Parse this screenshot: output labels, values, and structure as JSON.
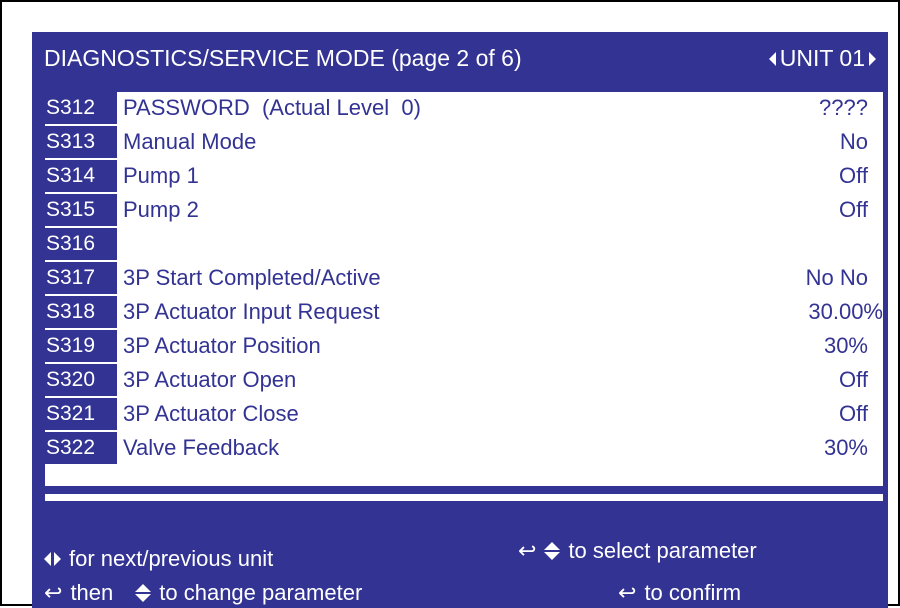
{
  "header": {
    "title": "DIAGNOSTICS/SERVICE MODE (page 2 of 6)",
    "unit": "UNIT 01"
  },
  "rows": [
    {
      "code": "S312",
      "label": "PASSWORD  (Actual Level  0)",
      "value": "????"
    },
    {
      "code": "S313",
      "label": "Manual Mode",
      "value": "No"
    },
    {
      "code": "S314",
      "label": "Pump 1",
      "value": "Off"
    },
    {
      "code": "S315",
      "label": "Pump 2",
      "value": "Off"
    },
    {
      "code": "S316",
      "label": "",
      "value": ""
    },
    {
      "code": "S317",
      "label": "3P Start Completed/Active",
      "value": "No No"
    },
    {
      "code": "S318",
      "label": "3P Actuator Input Request",
      "value": "30.00%"
    },
    {
      "code": "S319",
      "label": "3P Actuator Position",
      "value": "30%"
    },
    {
      "code": "S320",
      "label": "3P Actuator Open",
      "value": "Off"
    },
    {
      "code": "S321",
      "label": "3P Actuator Close",
      "value": "Off"
    },
    {
      "code": "S322",
      "label": "Valve Feedback",
      "value": "30%"
    }
  ],
  "footer": {
    "next_prev": "for next/previous unit",
    "select": "to select parameter",
    "then": "then",
    "change": "to change parameter",
    "confirm": "to confirm"
  },
  "icons": {
    "left_right": "left-right-arrows-icon",
    "up_down": "up-down-arrows-icon",
    "enter": "enter-return-icon"
  },
  "colors": {
    "panel": "#333393",
    "text_on_panel": "#ffffff",
    "list_bg": "#ffffff"
  }
}
